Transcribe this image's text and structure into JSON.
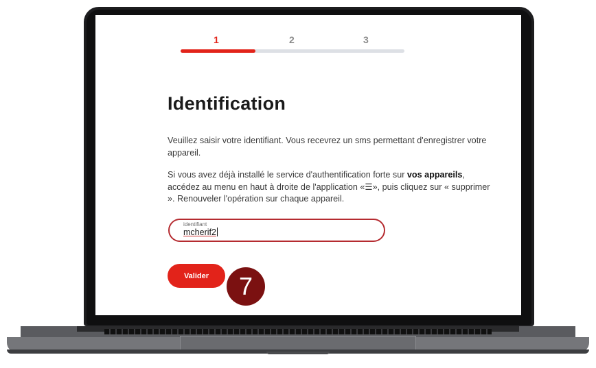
{
  "stepper": {
    "steps": [
      "1",
      "2",
      "3"
    ],
    "current_step": 1,
    "progress": 0.333
  },
  "page": {
    "title": "Identification",
    "para1": "Veuillez saisir votre identifiant. Vous recevrez un sms permettant d'enregistrer votre appareil.",
    "para2_a": "Si vous avez déjà installé le service d'authentification forte sur ",
    "para2_bold": "vos appareils",
    "para2_b": ", accédez au menu en haut à droite de l'application «☰», puis cliquez sur « supprimer ». Renouveler l'opération sur chaque appareil."
  },
  "form": {
    "field_label": "identifiant",
    "field_value": "mcherif2",
    "submit_label": "Valider"
  },
  "annotation": {
    "badge": "7"
  },
  "colors": {
    "accent": "#e2231a",
    "field_border": "#b52b30",
    "badge": "#7b1111"
  }
}
